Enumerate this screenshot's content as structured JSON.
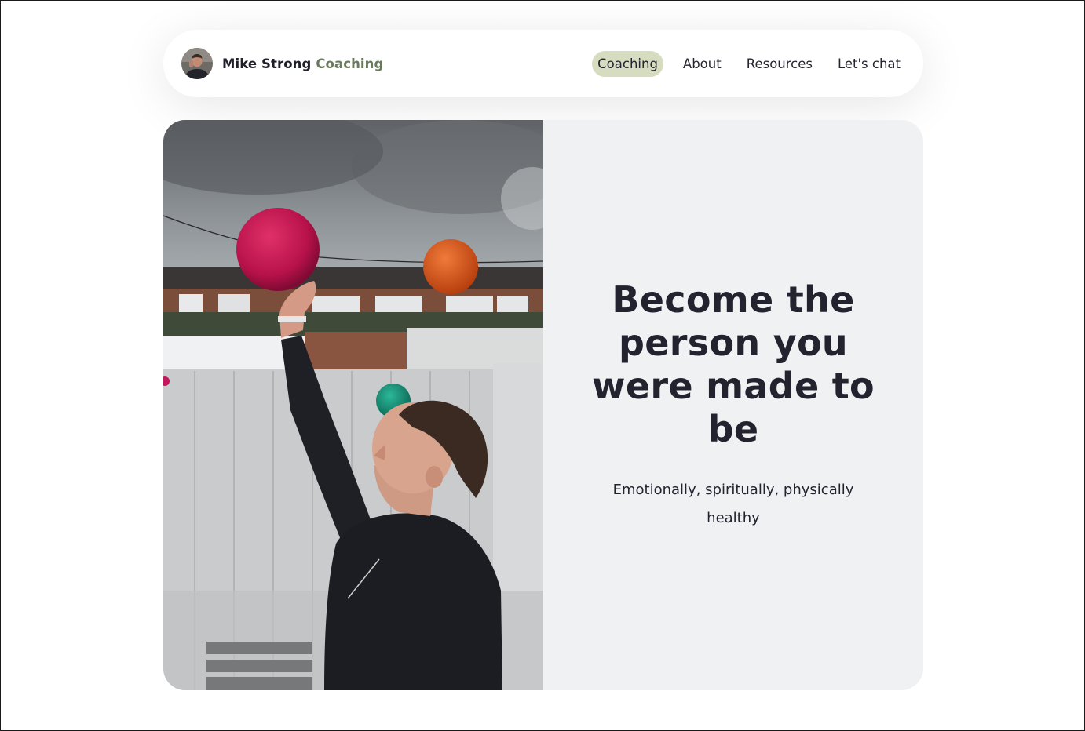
{
  "header": {
    "brand_name": "Mike Strong",
    "brand_accent": "Coaching",
    "nav": [
      {
        "label": "Coaching",
        "active": true
      },
      {
        "label": "About",
        "active": false
      },
      {
        "label": "Resources",
        "active": false
      },
      {
        "label": "Let's chat",
        "active": false
      }
    ]
  },
  "hero": {
    "title": "Become the person you were made to be",
    "subtitle": "Emotionally, spiritually, physically healthy"
  },
  "colors": {
    "accent": "#6b7a5e",
    "active_nav_bg": "#d6dcbf",
    "heading": "#23222f",
    "hero_bg": "#f0f1f3"
  }
}
